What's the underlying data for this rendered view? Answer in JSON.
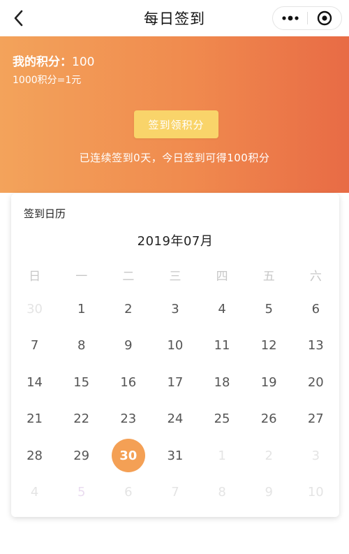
{
  "navbar": {
    "title": "每日签到",
    "back_icon": "chevron-left-icon",
    "more_icon": "more-dots-icon",
    "target_icon": "target-icon"
  },
  "hero": {
    "points_label": "我的积分：",
    "points_value": "100",
    "rate_text": "1000积分=1元",
    "checkin_button": "签到领积分",
    "streak_text": "已连续签到0天，今日签到可得100积分",
    "colors": {
      "start": "#f3a35b",
      "end": "#e86b45",
      "button": "#f9d46a"
    }
  },
  "calendar": {
    "title": "签到日历",
    "month": "2019年07月",
    "weekdays": [
      "日",
      "一",
      "二",
      "三",
      "四",
      "五",
      "六"
    ],
    "days": [
      {
        "d": "30",
        "other": true
      },
      {
        "d": "1"
      },
      {
        "d": "2"
      },
      {
        "d": "3"
      },
      {
        "d": "4"
      },
      {
        "d": "5"
      },
      {
        "d": "6"
      },
      {
        "d": "7"
      },
      {
        "d": "8"
      },
      {
        "d": "9"
      },
      {
        "d": "10"
      },
      {
        "d": "11"
      },
      {
        "d": "12"
      },
      {
        "d": "13"
      },
      {
        "d": "14"
      },
      {
        "d": "15"
      },
      {
        "d": "16"
      },
      {
        "d": "17"
      },
      {
        "d": "18"
      },
      {
        "d": "19"
      },
      {
        "d": "20"
      },
      {
        "d": "21"
      },
      {
        "d": "22"
      },
      {
        "d": "23"
      },
      {
        "d": "24"
      },
      {
        "d": "25"
      },
      {
        "d": "26"
      },
      {
        "d": "27"
      },
      {
        "d": "28"
      },
      {
        "d": "29"
      },
      {
        "d": "30",
        "today": true
      },
      {
        "d": "31"
      },
      {
        "d": "1",
        "other": true
      },
      {
        "d": "2",
        "other": true
      },
      {
        "d": "3",
        "other": true
      },
      {
        "d": "4",
        "other": true
      },
      {
        "d": "5",
        "other": true,
        "tint": true
      },
      {
        "d": "6",
        "other": true
      },
      {
        "d": "7",
        "other": true
      },
      {
        "d": "8",
        "other": true
      },
      {
        "d": "9",
        "other": true
      },
      {
        "d": "10",
        "other": true
      }
    ],
    "today_color": "#f4a055"
  }
}
